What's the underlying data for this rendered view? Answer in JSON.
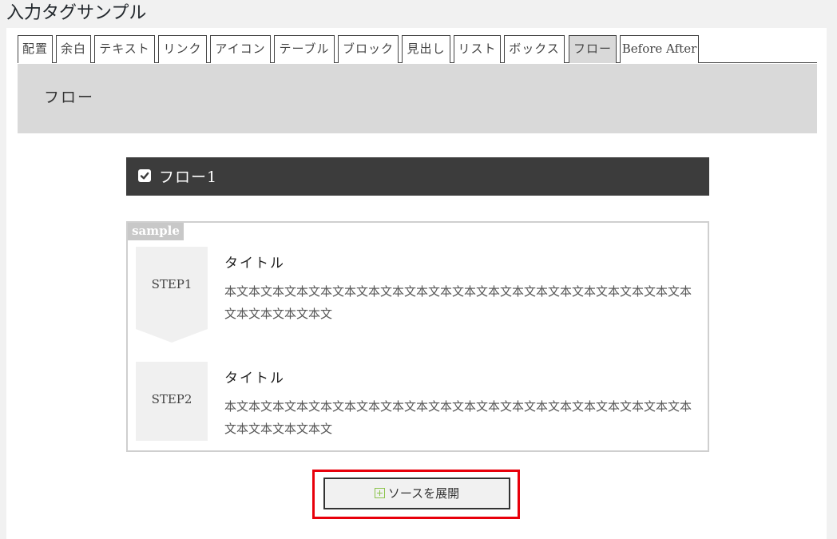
{
  "page": {
    "title": "入力タグサンプル"
  },
  "tabs": [
    {
      "label": "配置"
    },
    {
      "label": "余白"
    },
    {
      "label": "テキスト"
    },
    {
      "label": "リンク"
    },
    {
      "label": "アイコン"
    },
    {
      "label": "テーブル"
    },
    {
      "label": "ブロック"
    },
    {
      "label": "見出し"
    },
    {
      "label": "リスト"
    },
    {
      "label": "ボックス"
    },
    {
      "label": "フロー"
    },
    {
      "label": "Before After"
    }
  ],
  "active_tab": "フロー",
  "section": {
    "title": "フロー"
  },
  "heading": {
    "label": "フロー1",
    "icon": "checkbox-checked-icon"
  },
  "sample": {
    "tag": "sample",
    "steps": [
      {
        "label": "STEP1",
        "title": "タイトル",
        "text": "本文本文本文本文本文本文本文本文本文本文本文本文本文本文本文本文本文本文本文本文本文本文本文本文"
      },
      {
        "label": "STEP2",
        "title": "タイトル",
        "text": "本文本文本文本文本文本文本文本文本文本文本文本文本文本文本文本文本文本文本文本文本文本文本文本文"
      }
    ]
  },
  "expand_button": {
    "label": "ソースを展開",
    "icon": "plus-square-icon"
  },
  "colors": {
    "highlight": "#e8000b",
    "heading_bg": "#3c3c3c",
    "accent_green": "#8bc34a"
  }
}
